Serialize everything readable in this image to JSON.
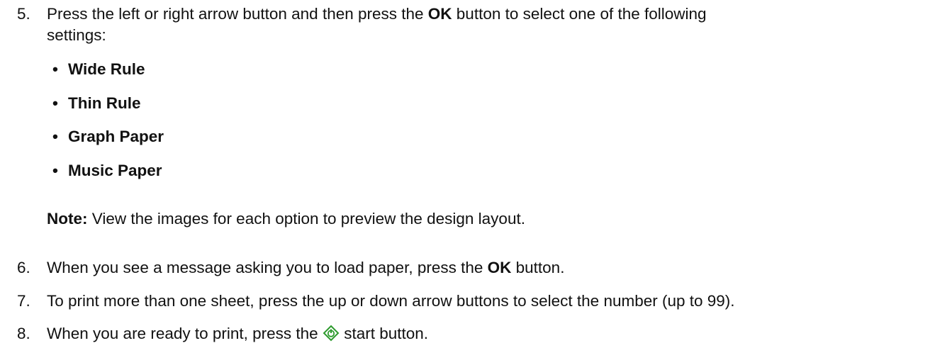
{
  "steps": {
    "s5": {
      "number": "5.",
      "line1_before": "Press the left or right arrow button and then press the ",
      "line1_bold": "OK",
      "line1_after": " button to select one of the following",
      "line2": "settings:"
    },
    "bullets": [
      "Wide Rule",
      "Thin Rule",
      "Graph Paper",
      "Music Paper"
    ],
    "note": {
      "label": "Note:",
      "text": " View the images for each option to preview the design layout."
    },
    "s6": {
      "number": "6.",
      "before": "When you see a message asking you to load paper, press the ",
      "bold": "OK",
      "after": " button."
    },
    "s7": {
      "number": "7.",
      "text": "To print more than one sheet, press the up or down arrow buttons to select the number (up to 99)."
    },
    "s8": {
      "number": "8.",
      "before": "When you are ready to print, press the ",
      "icon": "start-button-icon",
      "after": " start button."
    }
  },
  "colors": {
    "text": "#111111",
    "start_icon": "#2e9b2e"
  }
}
